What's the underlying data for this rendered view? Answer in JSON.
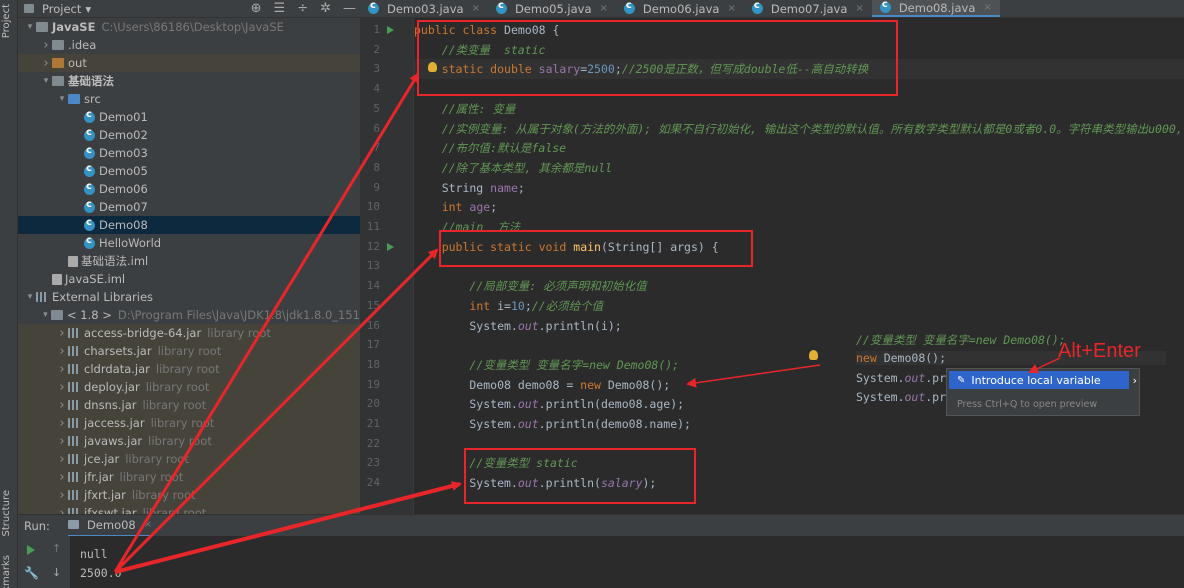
{
  "sidebar_tabs": {
    "project": "Project",
    "structure": "Structure",
    "bookmarks": "Bookmarks"
  },
  "project_panel": {
    "title": "Project",
    "dropdown": "▾"
  },
  "tree": [
    {
      "indent": 0,
      "arrow": "v",
      "icon": "folder",
      "label": "JavaSE",
      "extra": "C:\\Users\\86186\\Desktop\\JavaSE",
      "bold": true
    },
    {
      "indent": 1,
      "arrow": ">",
      "icon": "folder",
      "label": ".idea"
    },
    {
      "indent": 1,
      "arrow": ">",
      "icon": "folder-orange",
      "label": "out",
      "lib": true
    },
    {
      "indent": 1,
      "arrow": "v",
      "icon": "folder",
      "label": "基础语法",
      "bold": true
    },
    {
      "indent": 2,
      "arrow": "v",
      "icon": "folder-blue",
      "label": "src"
    },
    {
      "indent": 3,
      "icon": "class",
      "label": "Demo01"
    },
    {
      "indent": 3,
      "icon": "class",
      "label": "Demo02"
    },
    {
      "indent": 3,
      "icon": "class",
      "label": "Demo03"
    },
    {
      "indent": 3,
      "icon": "class",
      "label": "Demo05"
    },
    {
      "indent": 3,
      "icon": "class",
      "label": "Demo06"
    },
    {
      "indent": 3,
      "icon": "class",
      "label": "Demo07"
    },
    {
      "indent": 3,
      "icon": "class",
      "label": "Demo08",
      "selected": true
    },
    {
      "indent": 3,
      "icon": "class",
      "label": "HelloWorld"
    },
    {
      "indent": 2,
      "icon": "iml",
      "label": "基础语法.iml"
    },
    {
      "indent": 1,
      "icon": "iml",
      "label": "JavaSE.iml"
    },
    {
      "indent": 0,
      "arrow": "v",
      "icon": "libs",
      "label": "External Libraries"
    },
    {
      "indent": 1,
      "arrow": "v",
      "icon": "folder",
      "label": "< 1.8 >",
      "extra": "D:\\Program Files\\Java\\JDK1.8\\jdk1.8.0_151"
    },
    {
      "indent": 2,
      "arrow": ">",
      "icon": "jar",
      "label": "access-bridge-64.jar",
      "extra": "library root",
      "lib": true
    },
    {
      "indent": 2,
      "arrow": ">",
      "icon": "jar",
      "label": "charsets.jar",
      "extra": "library root",
      "lib": true
    },
    {
      "indent": 2,
      "arrow": ">",
      "icon": "jar",
      "label": "cldrdata.jar",
      "extra": "library root",
      "lib": true
    },
    {
      "indent": 2,
      "arrow": ">",
      "icon": "jar",
      "label": "deploy.jar",
      "extra": "library root",
      "lib": true
    },
    {
      "indent": 2,
      "arrow": ">",
      "icon": "jar",
      "label": "dnsns.jar",
      "extra": "library root",
      "lib": true
    },
    {
      "indent": 2,
      "arrow": ">",
      "icon": "jar",
      "label": "jaccess.jar",
      "extra": "library root",
      "lib": true
    },
    {
      "indent": 2,
      "arrow": ">",
      "icon": "jar",
      "label": "javaws.jar",
      "extra": "library root",
      "lib": true
    },
    {
      "indent": 2,
      "arrow": ">",
      "icon": "jar",
      "label": "jce.jar",
      "extra": "library root",
      "lib": true
    },
    {
      "indent": 2,
      "arrow": ">",
      "icon": "jar",
      "label": "jfr.jar",
      "extra": "library root",
      "lib": true
    },
    {
      "indent": 2,
      "arrow": ">",
      "icon": "jar",
      "label": "jfxrt.jar",
      "extra": "library root",
      "lib": true
    },
    {
      "indent": 2,
      "arrow": ">",
      "icon": "jar",
      "label": "jfxswt.jar",
      "extra": "library root",
      "lib": true
    }
  ],
  "tabs": [
    {
      "label": "Demo03.java"
    },
    {
      "label": "Demo05.java"
    },
    {
      "label": "Demo06.java"
    },
    {
      "label": "Demo07.java"
    },
    {
      "label": "Demo08.java",
      "active": true
    }
  ],
  "code_lines": [
    [
      [
        "k",
        "public class "
      ],
      [
        "t",
        "Demo08 {"
      ]
    ],
    [
      [
        "t",
        "    "
      ],
      [
        "c",
        "//类变量  static"
      ]
    ],
    [
      [
        "t",
        "    "
      ],
      [
        "k",
        "static double "
      ],
      [
        "s",
        "salary"
      ],
      [
        "t",
        "="
      ],
      [
        "n",
        "2500"
      ],
      [
        "t",
        ";"
      ],
      [
        "c",
        "//2500是正数，但写成double低--高自动转换"
      ]
    ],
    [],
    [
      [
        "t",
        "    "
      ],
      [
        "c",
        "//属性: 变量"
      ]
    ],
    [
      [
        "t",
        "    "
      ],
      [
        "c",
        "//实例变量: 从属于对象(方法的外面); 如果不自行初始化, 输出这个类型的默认值。所有数字类型默认都是0或者0.0。字符串类型输出u000,"
      ]
    ],
    [
      [
        "t",
        "    "
      ],
      [
        "c",
        "//布尔值:默认是false"
      ]
    ],
    [
      [
        "t",
        "    "
      ],
      [
        "c",
        "//除了基本类型, 其余都是null"
      ]
    ],
    [
      [
        "t",
        "    String "
      ],
      [
        "s",
        "name"
      ],
      [
        "t",
        ";"
      ]
    ],
    [
      [
        "t",
        "    "
      ],
      [
        "k",
        "int "
      ],
      [
        "s",
        "age"
      ],
      [
        "t",
        ";"
      ]
    ],
    [
      [
        "t",
        "    "
      ],
      [
        "c",
        "//main  方法"
      ]
    ],
    [
      [
        "t",
        "    "
      ],
      [
        "k",
        "public static void "
      ],
      [
        "m",
        "main"
      ],
      [
        "t",
        "(String[] args) {"
      ]
    ],
    [],
    [
      [
        "t",
        "        "
      ],
      [
        "c",
        "//局部变量: 必须声明和初始化值"
      ]
    ],
    [
      [
        "t",
        "        "
      ],
      [
        "k",
        "int "
      ],
      [
        "t",
        "i="
      ],
      [
        "n",
        "10"
      ],
      [
        "t",
        ";"
      ],
      [
        "c",
        "//必须给个值"
      ]
    ],
    [
      [
        "t",
        "        System."
      ],
      [
        "f",
        "out"
      ],
      [
        "t",
        ".println(i);"
      ]
    ],
    [],
    [
      [
        "t",
        "        "
      ],
      [
        "c",
        "//变量类型 变量名字=new Demo08();"
      ]
    ],
    [
      [
        "t",
        "        Demo08 demo08 = "
      ],
      [
        "k",
        "new "
      ],
      [
        "t",
        "Demo08();"
      ]
    ],
    [
      [
        "t",
        "        System."
      ],
      [
        "f",
        "out"
      ],
      [
        "t",
        ".println(demo08.age);"
      ]
    ],
    [
      [
        "t",
        "        System."
      ],
      [
        "f",
        "out"
      ],
      [
        "t",
        ".println(demo08.name);"
      ]
    ],
    [],
    [
      [
        "t",
        "        "
      ],
      [
        "c",
        "//变量类型 static"
      ]
    ],
    [
      [
        "t",
        "        System."
      ],
      [
        "f",
        "out"
      ],
      [
        "t",
        ".println("
      ],
      [
        "f",
        "salary"
      ],
      [
        "t",
        ");"
      ]
    ]
  ],
  "preview": {
    "line1": "//变量类型 变量名字=new Demo08();",
    "line2_kw": "new ",
    "line2": "Demo08();",
    "line3_a": "System.",
    "line3_b": "out",
    "line3_c": ".pr",
    "line4_a": "System.",
    "line4_b": "out",
    "line4_c": ".pr"
  },
  "intention_menu": {
    "item": "Introduce local variable",
    "hint": "Press Ctrl+Q to open preview"
  },
  "annotation": {
    "text": "Alt+Enter"
  },
  "run": {
    "label": "Run:",
    "config": "Demo08",
    "output": [
      "null",
      "2500.0"
    ]
  },
  "colors": {
    "annotation_red": "#e8262a",
    "selection": "#2f65ca"
  }
}
